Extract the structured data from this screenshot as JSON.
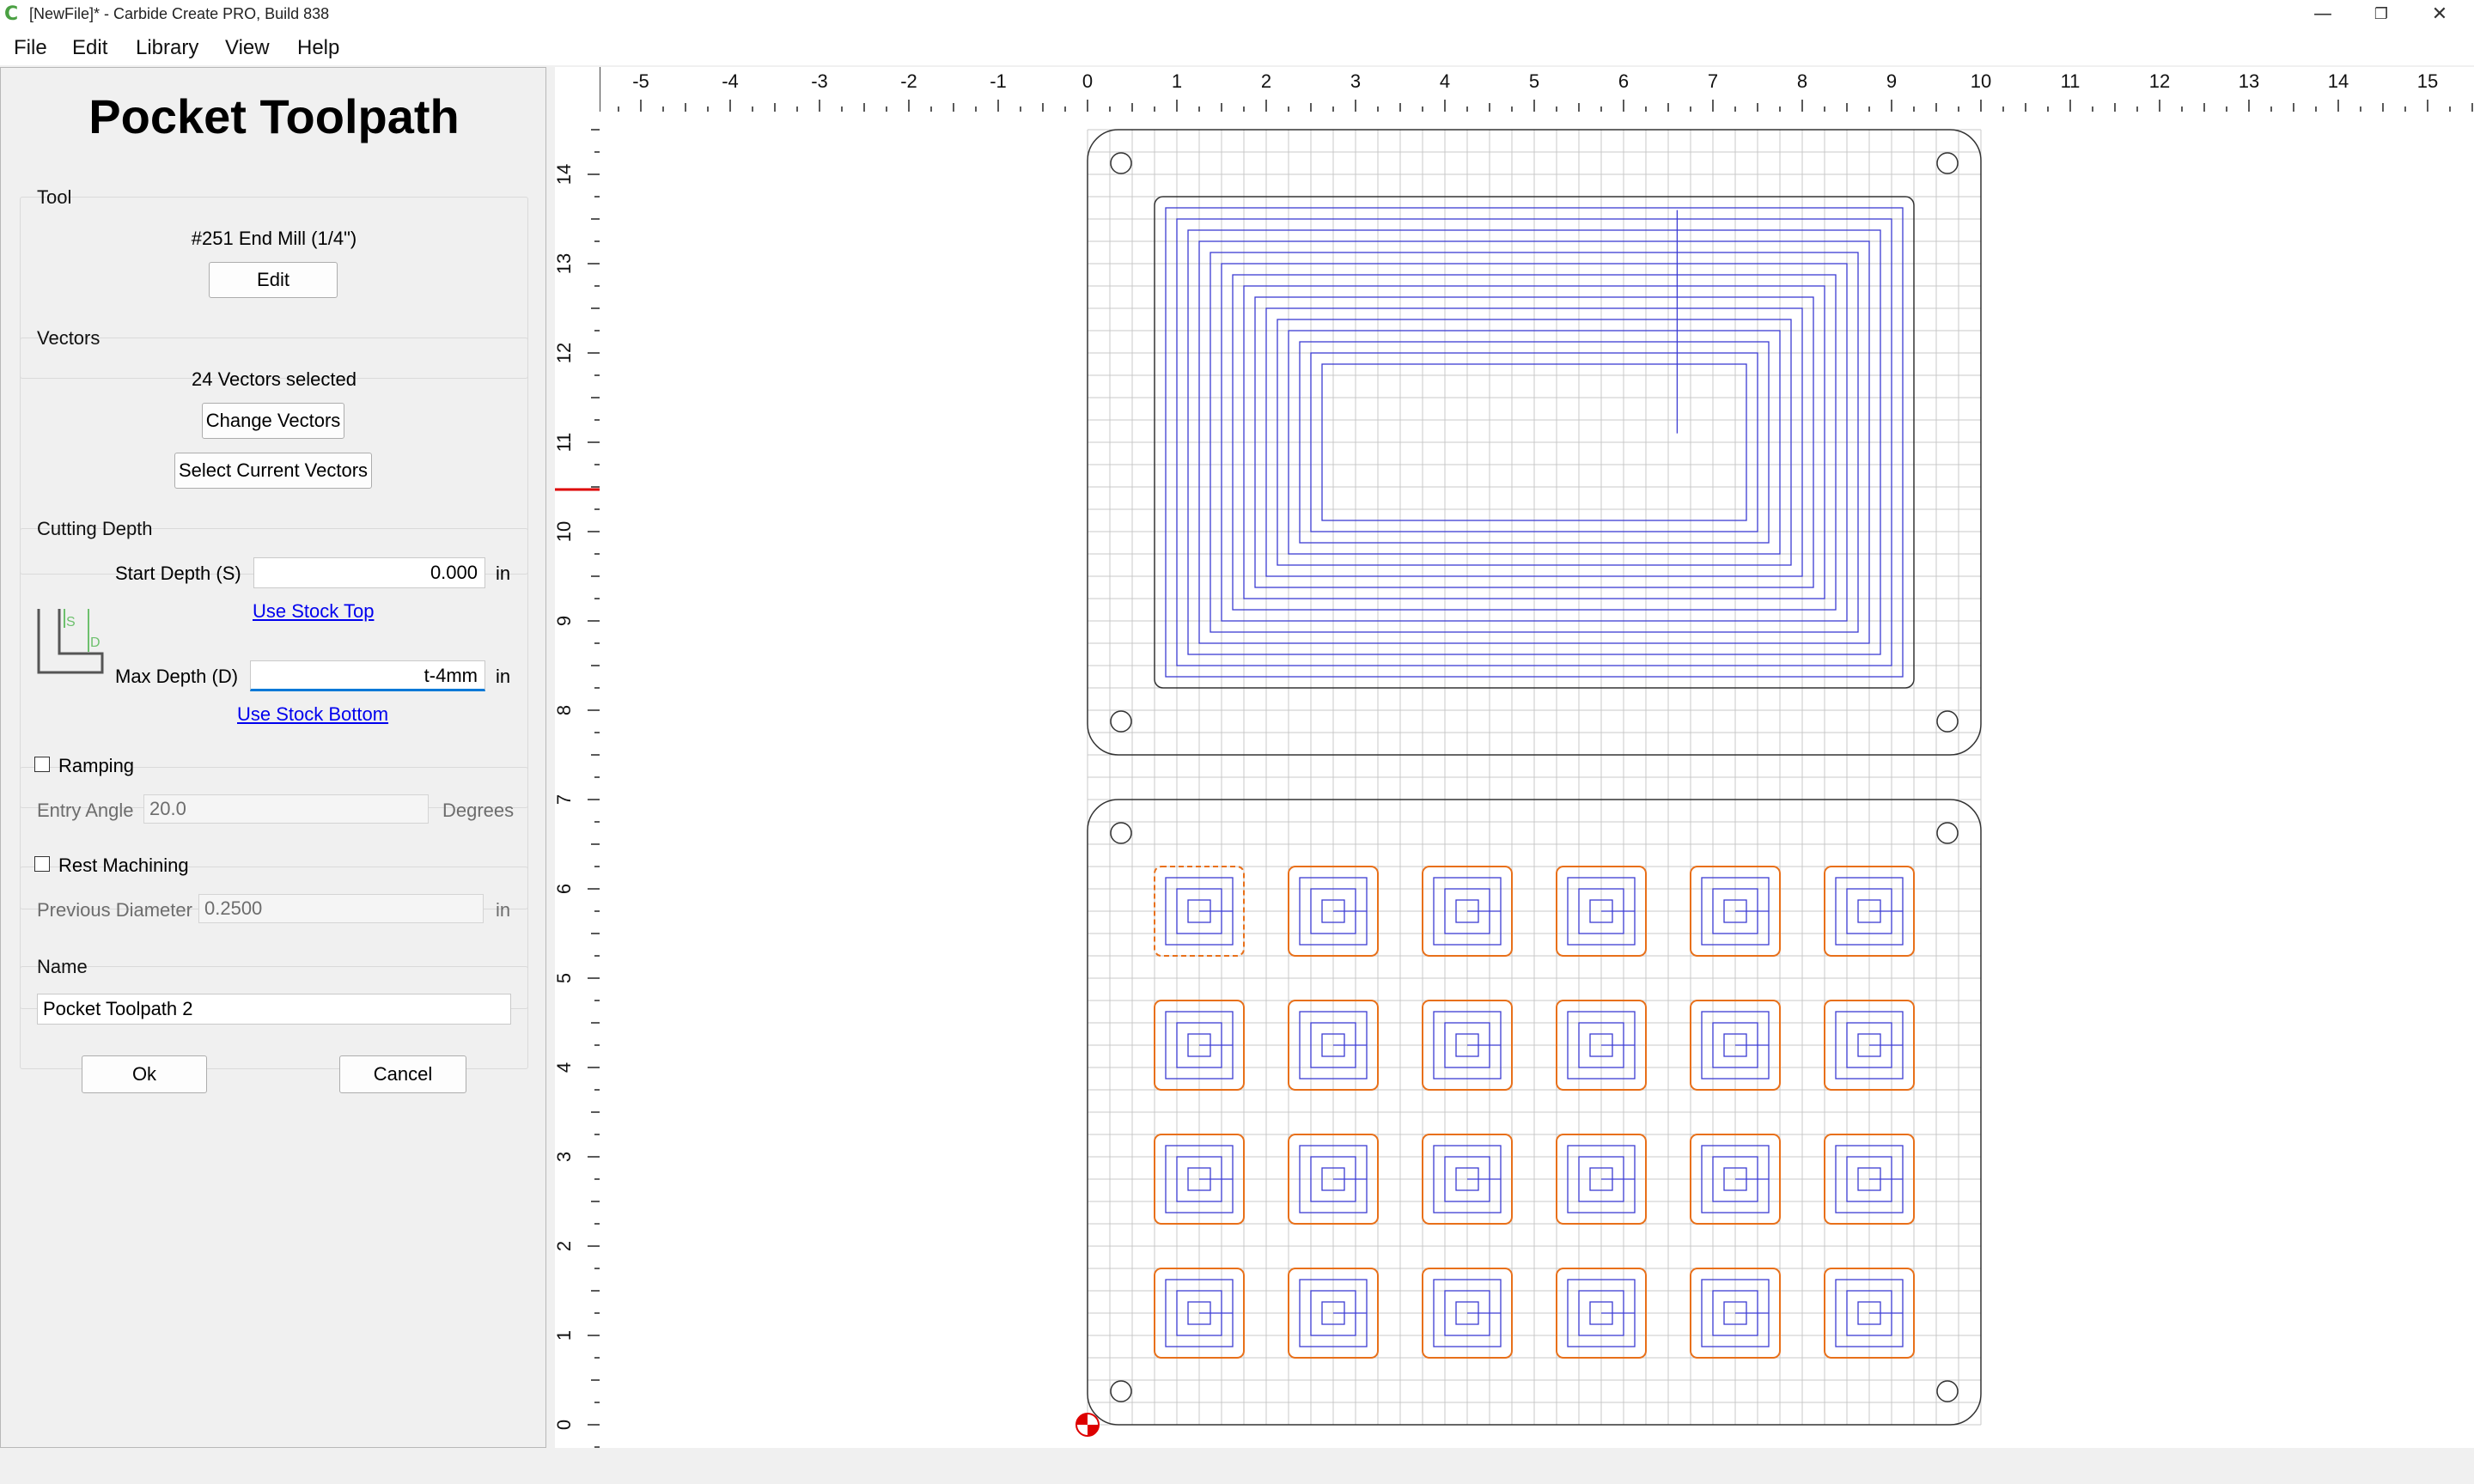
{
  "window": {
    "title": "[NewFile]* - Carbide Create PRO, Build 838",
    "minimize_glyph": "—",
    "maximize_glyph": "❐",
    "close_glyph": "✕",
    "app_icon": "carbide-c-icon"
  },
  "menu": [
    "File",
    "Edit",
    "Library",
    "View",
    "Help"
  ],
  "panel": {
    "title": "Pocket Toolpath",
    "tool": {
      "label": "Tool",
      "name": "#251 End Mill (1/4\")",
      "edit_button": "Edit"
    },
    "vectors": {
      "label": "Vectors",
      "status": "24 Vectors selected",
      "change_button": "Change Vectors",
      "select_button": "Select Current Vectors"
    },
    "cutting_depth": {
      "label": "Cutting Depth",
      "start_label": "Start Depth (S)",
      "start_value": "0.000",
      "start_unit": "in",
      "use_stock_top": "Use Stock Top",
      "max_label": "Max Depth (D)",
      "max_value": "t-4mm",
      "max_unit": "in",
      "use_stock_bottom": "Use Stock Bottom",
      "diagram_s": "S",
      "diagram_d": "D"
    },
    "ramping": {
      "label": "Ramping",
      "checked": false,
      "entry_angle_label": "Entry Angle",
      "entry_angle_value": "20.0",
      "entry_angle_unit": "Degrees"
    },
    "rest_machining": {
      "label": "Rest Machining",
      "checked": false,
      "prev_diameter_label": "Previous Diameter",
      "prev_diameter_value": "0.2500",
      "prev_diameter_unit": "in"
    },
    "name": {
      "label": "Name",
      "value": "Pocket Toolpath 2"
    },
    "ok_button": "Ok",
    "cancel_button": "Cancel"
  },
  "canvas": {
    "ruler_top_labels": [
      "-5",
      "-4",
      "-3",
      "-2",
      "-1",
      "0",
      "1",
      "2",
      "3",
      "4",
      "5",
      "6",
      "7",
      "8",
      "9",
      "10",
      "11",
      "12",
      "13",
      "14",
      "15"
    ],
    "ruler_left_labels": [
      "0",
      "1",
      "2",
      "3",
      "4",
      "5",
      "6",
      "7",
      "8",
      "9",
      "10",
      "11",
      "12",
      "13",
      "14"
    ],
    "colors": {
      "grid": "#c8c8c8",
      "outline": "#333333",
      "toolpath": "#3c3cd2",
      "pocket_outline": "#e8701a",
      "ruler_marker": "#dd0000",
      "origin": "#dd0000"
    },
    "large_pocket": {
      "x_range": [
        0.75,
        9.25
      ],
      "y_range": [
        8.25,
        13.75
      ],
      "passes": 15
    },
    "small_pockets": {
      "columns": 6,
      "rows": 4,
      "size_in": 1.0,
      "selected_index": 0
    }
  }
}
